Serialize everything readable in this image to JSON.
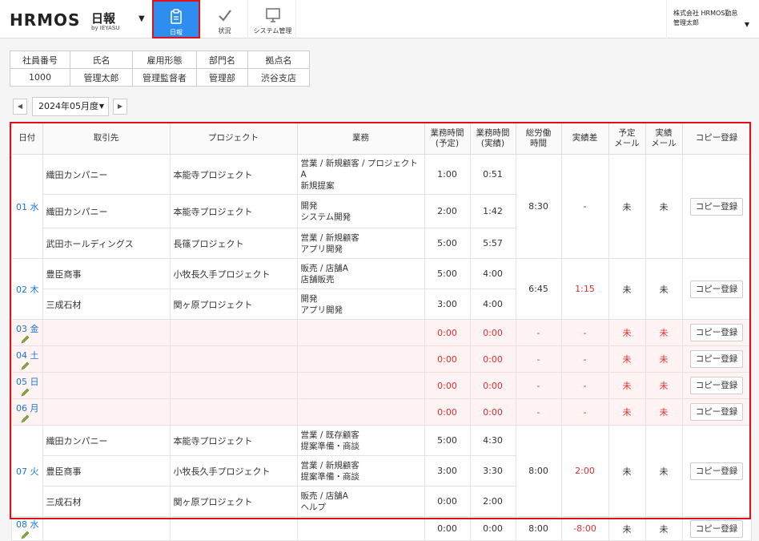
{
  "header": {
    "logo": "HRMOS",
    "logo_jp": "日報",
    "logo_sub": "by IEYASU",
    "nav": [
      {
        "label": "日報",
        "icon": "clipboard-icon"
      },
      {
        "label": "状況",
        "icon": "check-icon"
      },
      {
        "label": "システム管理",
        "icon": "monitor-icon"
      }
    ],
    "company": "株式会社 HRMOS勤怠",
    "user": "管理太郎"
  },
  "employee": {
    "headers": [
      "社員番号",
      "氏名",
      "雇用形態",
      "部門名",
      "拠点名"
    ],
    "values": [
      "1000",
      "管理太郎",
      "管理監督者",
      "管理部",
      "渋谷支店"
    ]
  },
  "month": "2024年05月度",
  "table": {
    "headers": [
      "日付",
      "取引先",
      "プロジェクト",
      "業務",
      "業務時間\n(予定)",
      "業務時間\n(実績)",
      "総労働\n時間",
      "実績差",
      "予定\nメール",
      "実績\nメール",
      "コピー登録"
    ],
    "copy_label": "コピー登録",
    "days": [
      {
        "date": "01 水",
        "total": "8:30",
        "diff": "-",
        "plan_mail": "未",
        "actual_mail": "未",
        "rows": [
          {
            "client": "織田カンパニー",
            "project": "本能寺プロジェクト",
            "task": "営業 / 新規顧客 / プロジェクトA\n新規提案",
            "plan": "1:00",
            "actual": "0:51"
          },
          {
            "client": "織田カンパニー",
            "project": "本能寺プロジェクト",
            "task": "開発\nシステム開発",
            "plan": "2:00",
            "actual": "1:42"
          },
          {
            "client": "武田ホールディングス",
            "project": "長篠プロジェクト",
            "task": "営業 / 新規顧客\nアプリ開発",
            "plan": "5:00",
            "actual": "5:57"
          }
        ]
      },
      {
        "date": "02 木",
        "total": "6:45",
        "diff": "1:15",
        "plan_mail": "未",
        "actual_mail": "未",
        "rows": [
          {
            "client": "豊臣商事",
            "project": "小牧長久手プロジェクト",
            "task": "販売 / 店舗A\n店舗販売",
            "plan": "5:00",
            "actual": "4:00"
          },
          {
            "client": "三成石材",
            "project": "関ヶ原プロジェクト",
            "task": "開発\nアプリ開発",
            "plan": "3:00",
            "actual": "4:00"
          }
        ]
      }
    ],
    "empty_days": [
      {
        "date": "03 金",
        "plan": "0:00",
        "actual": "0:00",
        "total": "-",
        "diff": "-",
        "plan_mail": "未",
        "actual_mail": "未"
      },
      {
        "date": "04 土",
        "plan": "0:00",
        "actual": "0:00",
        "total": "-",
        "diff": "-",
        "plan_mail": "未",
        "actual_mail": "未"
      },
      {
        "date": "05 日",
        "plan": "0:00",
        "actual": "0:00",
        "total": "-",
        "diff": "-",
        "plan_mail": "未",
        "actual_mail": "未"
      },
      {
        "date": "06 月",
        "plan": "0:00",
        "actual": "0:00",
        "total": "-",
        "diff": "-",
        "plan_mail": "未",
        "actual_mail": "未"
      }
    ],
    "day7": {
      "date": "07 火",
      "total": "8:00",
      "diff": "2:00",
      "plan_mail": "未",
      "actual_mail": "未",
      "rows": [
        {
          "client": "織田カンパニー",
          "project": "本能寺プロジェクト",
          "task": "営業 / 既存顧客\n提案準備・商談",
          "plan": "5:00",
          "actual": "4:30"
        },
        {
          "client": "豊臣商事",
          "project": "小牧長久手プロジェクト",
          "task": "営業 / 新規顧客\n提案準備・商談",
          "plan": "3:00",
          "actual": "3:30"
        },
        {
          "client": "三成石材",
          "project": "関ヶ原プロジェクト",
          "task": "販売 / 店舗A\nヘルプ",
          "plan": "0:00",
          "actual": "2:00"
        }
      ]
    },
    "day8": {
      "date": "08 水",
      "plan": "0:00",
      "actual": "0:00",
      "total": "8:00",
      "diff": "-8:00",
      "plan_mail": "未",
      "actual_mail": "未"
    }
  },
  "colors": {
    "accent": "#2e8ef0",
    "highlight": "#e0101a",
    "warn": "#e03030",
    "link": "#1a76d2"
  }
}
